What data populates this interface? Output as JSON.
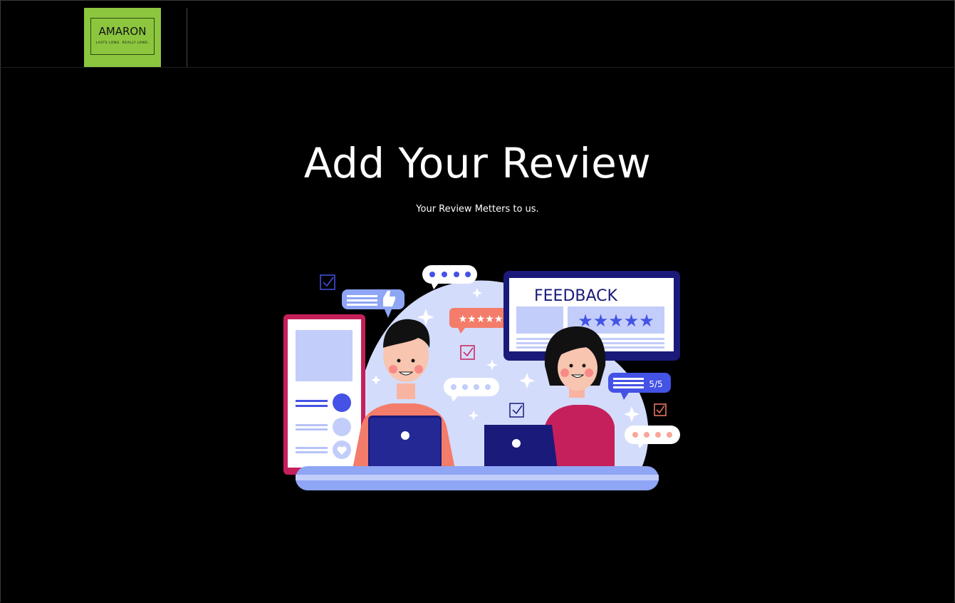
{
  "header": {
    "logo": {
      "brand": "AMARON",
      "tagline": "LASTS LONG. REALLY LONG."
    }
  },
  "main": {
    "title": "Add Your Review",
    "subtitle": "Your Review Metters to us."
  },
  "illustration": {
    "feedback_label": "FEEDBACK",
    "rating_label": "5/5",
    "colors": {
      "panel_blue": "#1a1a7a",
      "light_blue": "#c9d4fb",
      "accent_blue": "#4452e6",
      "pink": "#c5205b",
      "coral": "#f47c6a"
    }
  }
}
